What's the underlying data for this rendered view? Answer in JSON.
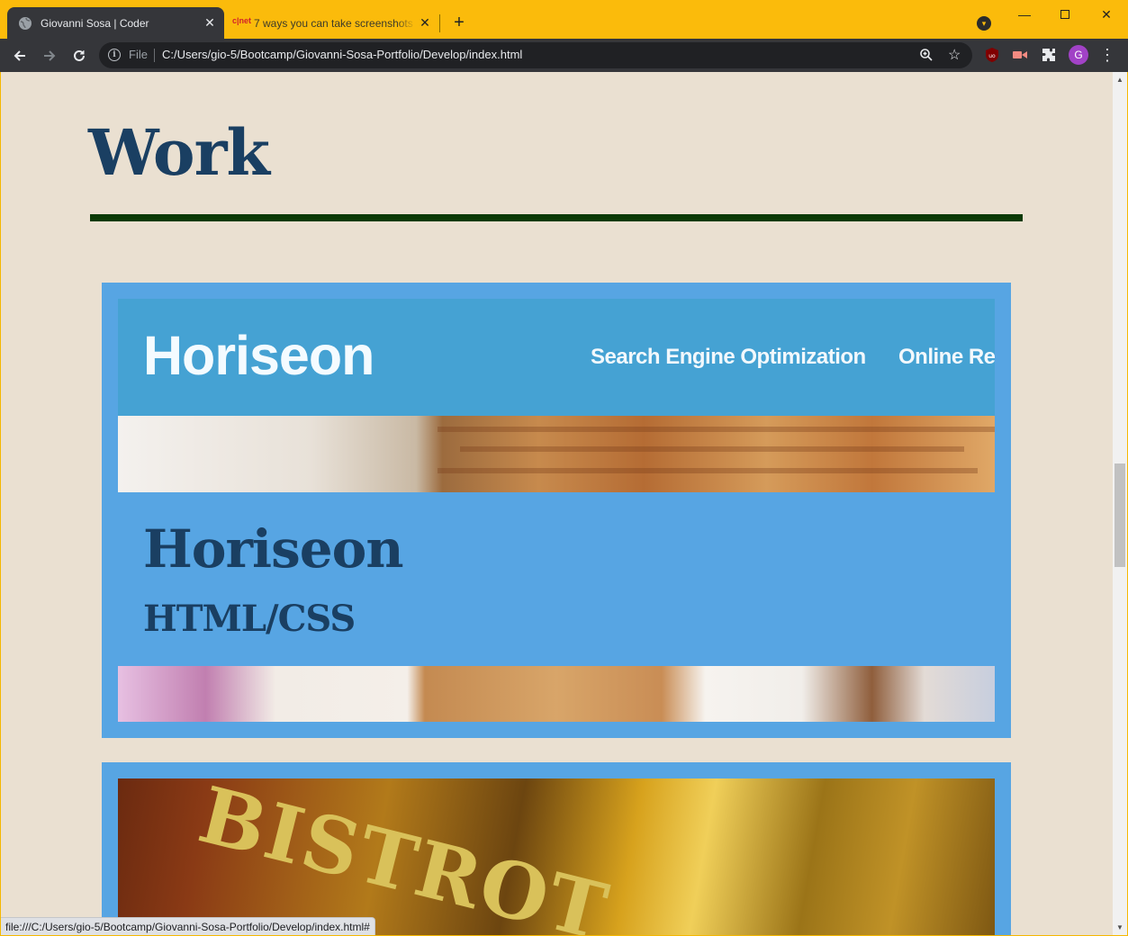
{
  "browser": {
    "tabs": [
      {
        "title": "Giovanni Sosa | Coder",
        "active": true,
        "favicon": "globe-icon"
      },
      {
        "title": "7 ways you can take screenshots",
        "active": false,
        "favicon": "cnet-icon",
        "favicon_text": "c|net"
      }
    ],
    "scheme_label": "File",
    "url": "C:/Users/gio-5/Bootcamp/Giovanni-Sosa-Portfolio/Develop/index.html",
    "profile_initial": "G",
    "status_url": "file:///C:/Users/gio-5/Bootcamp/Giovanni-Sosa-Portfolio/Develop/index.html#"
  },
  "page": {
    "section_title": "Work",
    "projects": [
      {
        "screenshot": {
          "logo": "Horiseon",
          "nav": [
            "Search Engine Optimization",
            "Online Re"
          ]
        },
        "name": "Horiseon",
        "tech": "HTML/CSS"
      },
      {
        "screenshot": {
          "sign": "BISTROT"
        }
      }
    ]
  },
  "colors": {
    "tab_strip": "#fbbb0b",
    "page_bg": "#eae0d1",
    "heading": "#1a3f62",
    "rule": "#0b3a05",
    "card_bg": "#57a5e3",
    "screenshot_header": "#45a2d3"
  }
}
